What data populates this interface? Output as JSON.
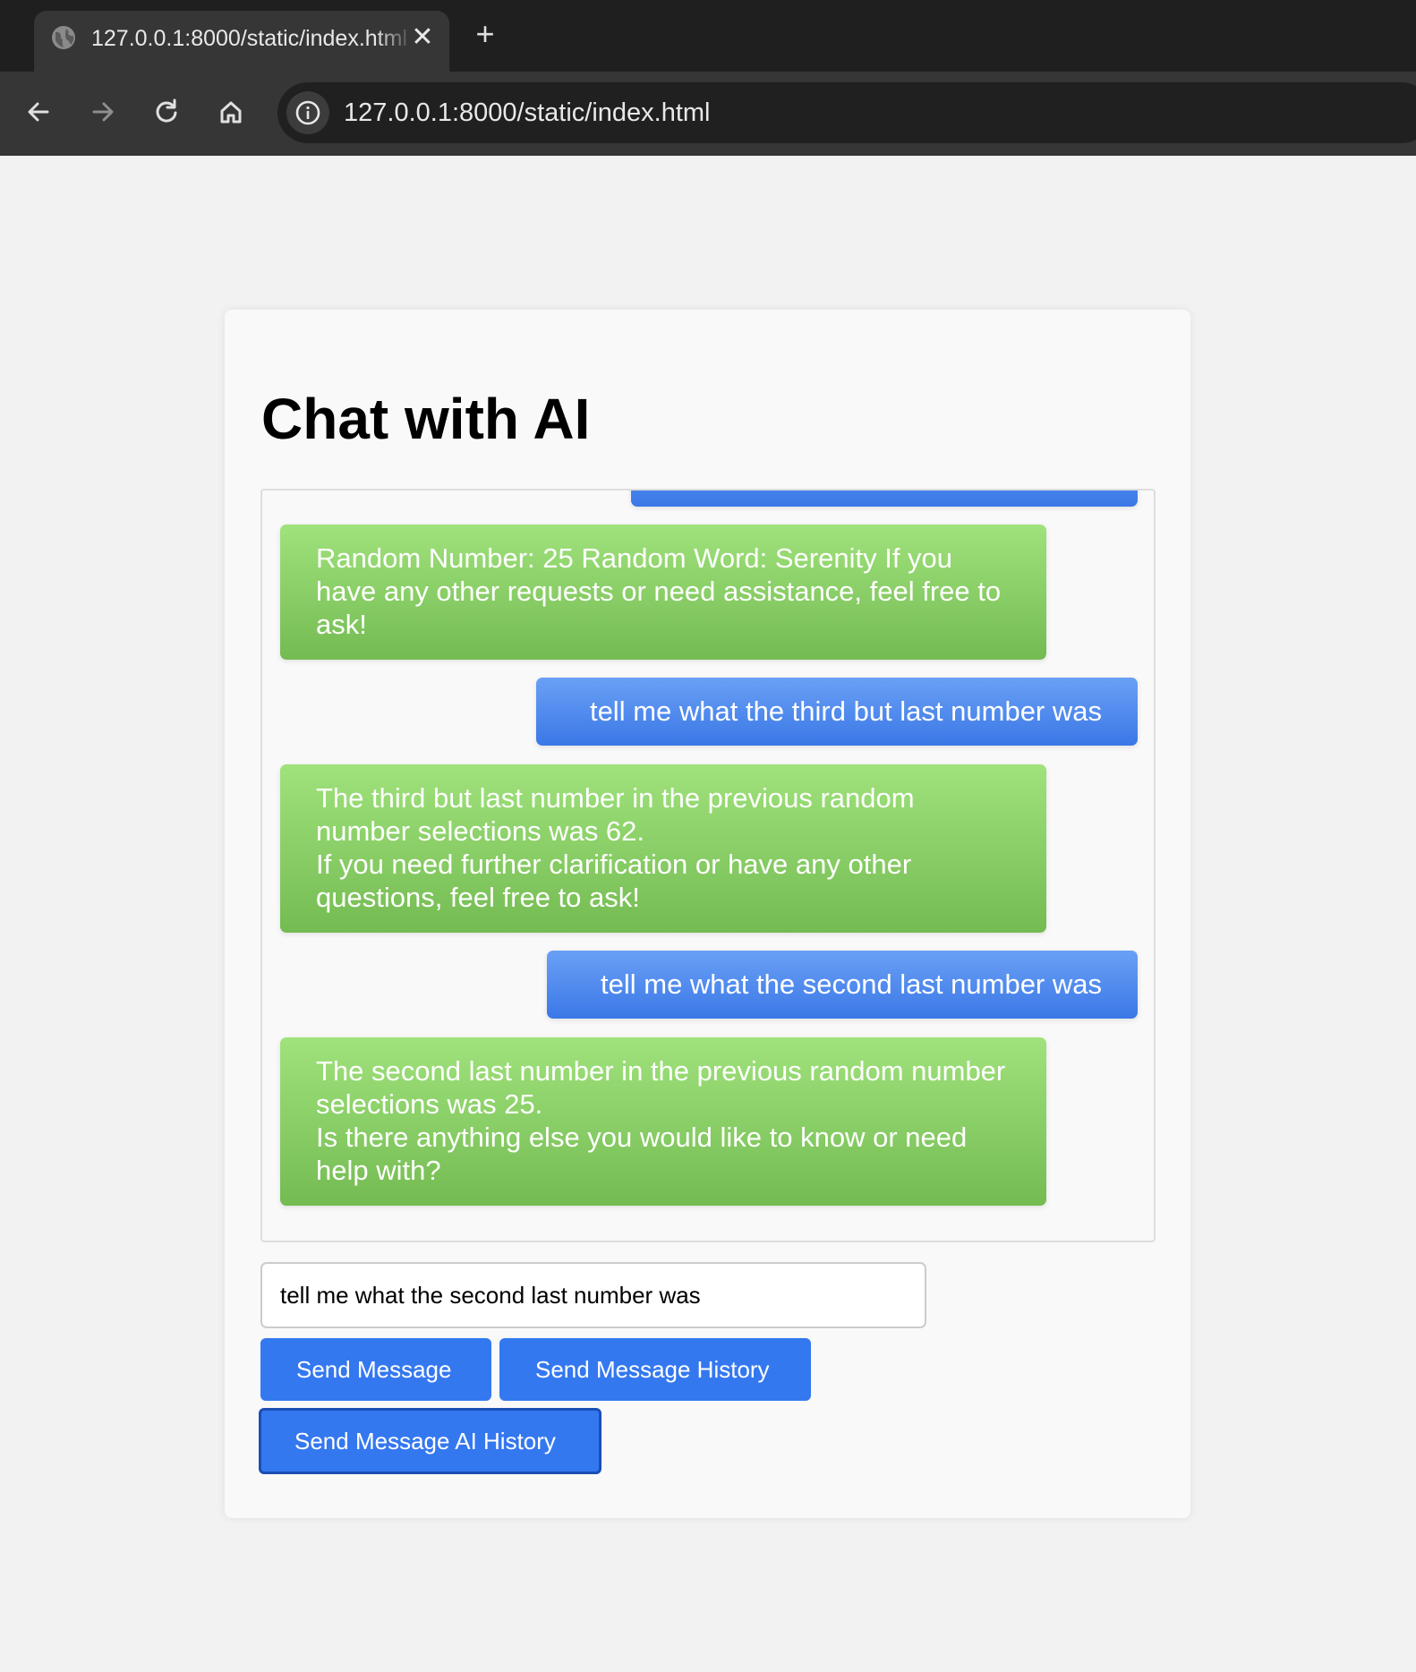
{
  "browser": {
    "tab_title": "127.0.0.1:8000/static/index.html",
    "url": "127.0.0.1:8000/static/index.html",
    "icons": {
      "tab_favicon": "globe-icon",
      "tab_close": "close-icon",
      "new_tab": "plus-icon",
      "back": "arrow-left-icon",
      "forward": "arrow-right-icon",
      "reload": "reload-icon",
      "home": "home-icon",
      "site_info": "info-icon"
    }
  },
  "page": {
    "title": "Chat with AI",
    "messages": [
      {
        "role": "user",
        "text": ""
      },
      {
        "role": "ai",
        "text": "Random Number: 25 Random Word: Serenity If you have any other requests or need assistance, feel free to ask!"
      },
      {
        "role": "user",
        "text": "tell me what the third but last number was"
      },
      {
        "role": "ai",
        "text": "The third but last number in the previous random number selections was 62.\nIf you need further clarification or have any other questions, feel free to ask!"
      },
      {
        "role": "user",
        "text": "tell me what the second last number was"
      },
      {
        "role": "ai",
        "text": "The second last number in the previous random number selections was 25.\nIs there anything else you would like to know or need help with?"
      }
    ],
    "input": {
      "value": "tell me what the second last number was"
    },
    "buttons": {
      "send_message": "Send Message",
      "send_message_history": "Send Message History",
      "send_message_ai_history": "Send Message AI History"
    },
    "colors": {
      "user_bubble": "#3b78e7",
      "ai_bubble": "#74bb52",
      "button": "#3478f0"
    }
  }
}
